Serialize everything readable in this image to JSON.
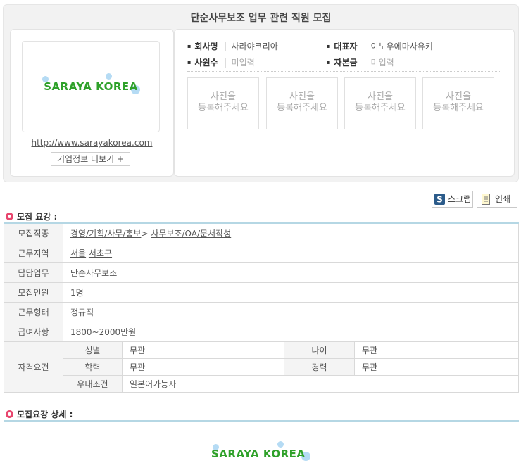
{
  "job_title": "단순사무보조 업무 관련 직원 모집",
  "company": {
    "logo_text": "SARAYA KOREA",
    "url": "http://www.sarayakorea.com",
    "more_label": "기업정보 더보기 +",
    "name_label": "회사명",
    "name": "사라야코리아",
    "ceo_label": "대표자",
    "ceo": "이노우에마사유키",
    "employees_label": "사원수",
    "employees": "미입력",
    "capital_label": "자본금",
    "capital": "미입력",
    "photo_placeholder": "사진을\n등록해주세요"
  },
  "actions": {
    "scrap_label": "스크랩",
    "print_label": "인쇄"
  },
  "requirements": {
    "section_title": "모집 요강 :",
    "job_type_label": "모집직종",
    "job_type_cat": "경영/기획/사무/홍보",
    "job_type_sep": ">",
    "job_type_sub": "사무보조/OA/문서작성",
    "location_label": "근무지역",
    "location_city": "서울",
    "location_district": "서초구",
    "duty_label": "담당업무",
    "duty": "단순사무보조",
    "headcount_label": "모집인원",
    "headcount": "1명",
    "work_type_label": "근무형태",
    "work_type": "정규직",
    "salary_label": "급여사항",
    "salary": "1800~2000만원",
    "qual_label": "자격요건",
    "gender_label": "성별",
    "gender": "무관",
    "age_label": "나이",
    "age": "무관",
    "edu_label": "학력",
    "edu": "무관",
    "career_label": "경력",
    "career": "무관",
    "pref_label": "우대조건",
    "pref": "일본어가능자"
  },
  "detail": {
    "section_title": "모집요강 상세 :",
    "logo_text": "SARAYA KOREA"
  }
}
